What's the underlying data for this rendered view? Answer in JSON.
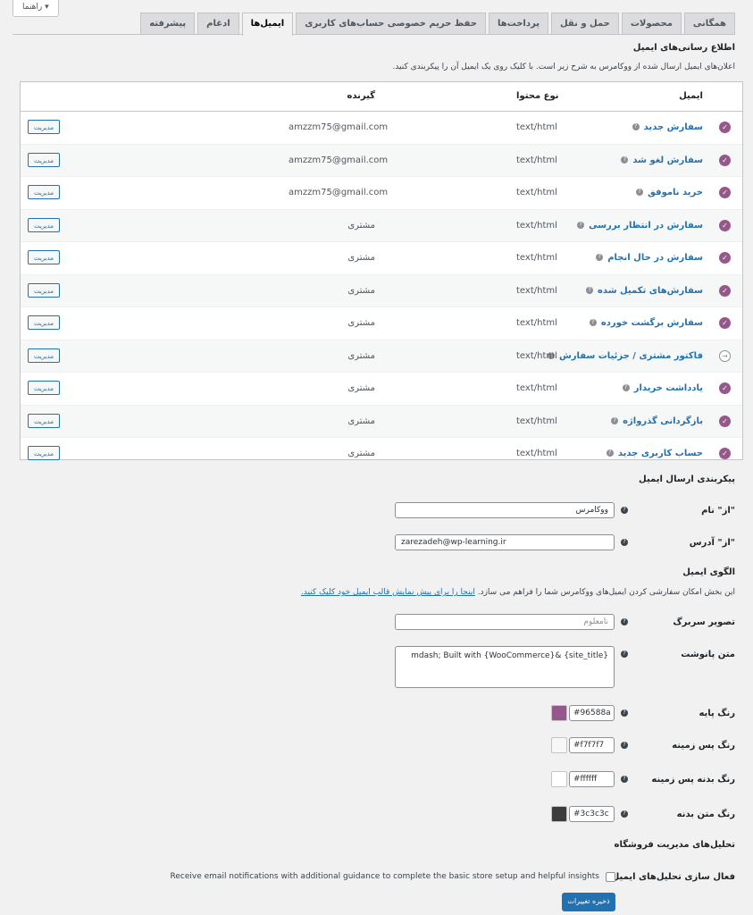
{
  "help_tab": "راهنما ▾",
  "tabs": [
    {
      "label": "همگانی"
    },
    {
      "label": "محصولات"
    },
    {
      "label": "حمل و نقل"
    },
    {
      "label": "پرداخت‌ها"
    },
    {
      "label": "حفظ حریم خصوصی حساب‌های کاربری"
    },
    {
      "label": "ایمیل‌ها",
      "active": true
    },
    {
      "label": "ادغام"
    },
    {
      "label": "پیشرفته"
    }
  ],
  "notifications": {
    "title": "اطلاع رسانی‌های ایمیل",
    "description": "اعلان‌های ایمیل ارسال شده از ووکامرس به شرح زیر است. با کلیک روی یک ایمیل آن را پیکربندی کنید.",
    "headers": {
      "email": "ایمیل",
      "content_type": "نوع محتوا",
      "recipient": "گیرنده"
    },
    "manage_label": "مدیریت",
    "rows": [
      {
        "name": "سفارش جدید",
        "type": "text/html",
        "recipient": "amzzm75@gmail.com",
        "enabled": true
      },
      {
        "name": "سفارش لغو شد",
        "type": "text/html",
        "recipient": "amzzm75@gmail.com",
        "enabled": true
      },
      {
        "name": "خرید ناموفق",
        "type": "text/html",
        "recipient": "amzzm75@gmail.com",
        "enabled": true
      },
      {
        "name": "سفارش در انتظار بررسی",
        "type": "text/html",
        "recipient": "مشتری",
        "enabled": true
      },
      {
        "name": "سفارش در حال انجام",
        "type": "text/html",
        "recipient": "مشتری",
        "enabled": true
      },
      {
        "name": "سفارش‌های تکمیل شده",
        "type": "text/html",
        "recipient": "مشتری",
        "enabled": true
      },
      {
        "name": "سفارش برگشت خورده",
        "type": "text/html",
        "recipient": "مشتری",
        "enabled": true
      },
      {
        "name": "فاکتور مشتری / جزئیات سفارش",
        "type": "text/html",
        "recipient": "مشتری",
        "enabled": false
      },
      {
        "name": "یادداشت خریدار",
        "type": "text/html",
        "recipient": "مشتری",
        "enabled": true
      },
      {
        "name": "بازگردانی گذرواژه",
        "type": "text/html",
        "recipient": "مشتری",
        "enabled": true
      },
      {
        "name": "حساب کاربری جدید",
        "type": "text/html",
        "recipient": "مشتری",
        "enabled": true
      }
    ]
  },
  "sender": {
    "title": "پیکربندی ارسال ایمیل",
    "from_name_label": "\"از\" نام",
    "from_name_value": "ووکامرس",
    "from_address_label": "\"از\" آدرس",
    "from_address_value": "zarezadeh@wp-learning.ir"
  },
  "template": {
    "title": "الگوی ایمیل",
    "desc_text": "این بخش امکان سفارشی کردن ایمیل‌های ووکامرس شما را فراهم می سازد.",
    "desc_link": "اینجا را برای پیش نمایش قالب ایمیل خود کلیک کنید.",
    "header_image_label": "تصویر سربرگ",
    "header_image_placeholder": "نامعلوم",
    "footer_text_label": "متن پانوشت",
    "footer_text_value": "mdash; Built with {WooCommerce}& {site_title}",
    "base_color_label": "رنگ پایه",
    "base_color": "#96588a",
    "bg_color_label": "رنگ پس زمینه",
    "bg_color": "#f7f7f7",
    "body_bg_label": "رنگ بدنه پس زمینه",
    "body_bg_color": "#ffffff",
    "body_text_label": "رنگ متن بدنه",
    "body_text_color": "#3c3c3c"
  },
  "insights": {
    "title": "تحلیل‌های مدیریت فروشگاه",
    "enable_label": "فعال سازی تحلیل‌های ایمیل",
    "checkbox_text": "Receive email notifications with additional guidance to complete the basic store setup and helpful insights"
  },
  "save_label": "ذخیره تغییرات"
}
